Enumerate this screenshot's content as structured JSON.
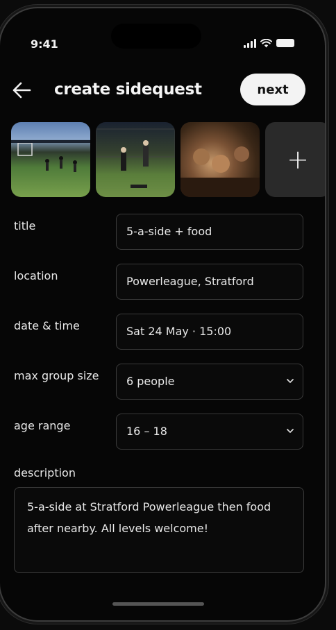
{
  "status_bar": {
    "time": "9:41"
  },
  "header": {
    "back_icon": "arrow-left-icon",
    "title": "create sidequest",
    "next_label": "next"
  },
  "photos": {
    "add_icon": "plus-icon",
    "add_glyph": "+"
  },
  "form": {
    "title": {
      "label": "title",
      "value": "5-a-side + food"
    },
    "location": {
      "label": "location",
      "value": "Powerleague, Stratford"
    },
    "datetime": {
      "label": "date & time",
      "value": "Sat 24 May · 15:00"
    },
    "group_size": {
      "label": "max group size",
      "value": "6 people"
    },
    "age_range": {
      "label": "age range",
      "value": "16 – 18"
    },
    "description": {
      "label": "description",
      "value": "5-a-side at Stratford Powerleague then food after nearby. All levels welcome!"
    }
  },
  "colors": {
    "background": "#060606",
    "field_border": "#3a3a3a",
    "button": "#f3f3f3",
    "text": "#e8e8e8"
  }
}
